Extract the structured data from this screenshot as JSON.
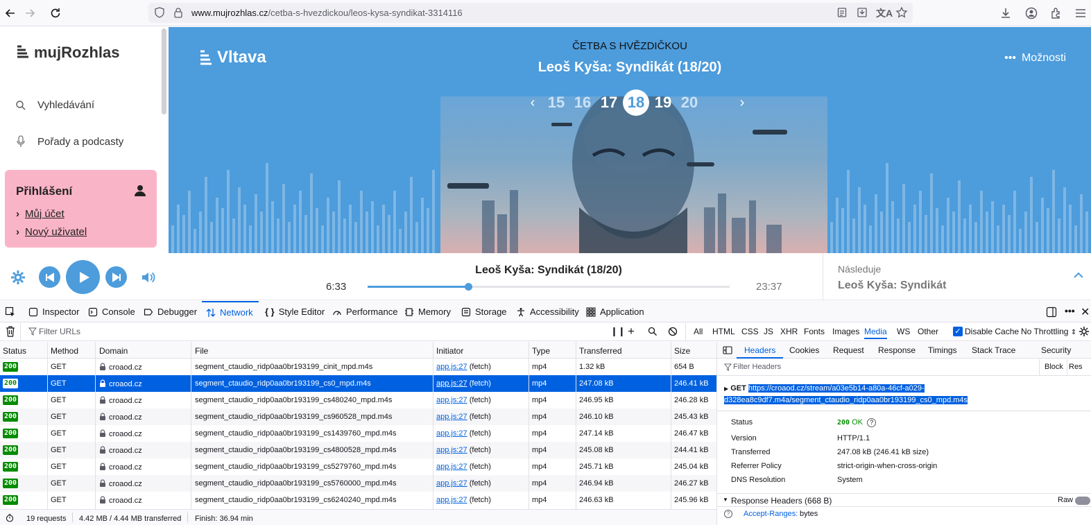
{
  "browser": {
    "url_domain": "www.mujrozhlas.cz",
    "url_path": "/cetba-s-hvezdickou/leos-kysa-syndikat-3314116"
  },
  "sidebar": {
    "logo": "mujRozhlas",
    "nav": [
      {
        "label": "Vyhledávání",
        "icon": "search-icon"
      },
      {
        "label": "Pořady a podcasty",
        "icon": "microphone-icon"
      }
    ],
    "login": {
      "title": "Přihlášení",
      "links": [
        "Můj účet",
        "Nový uživatel"
      ]
    }
  },
  "hero": {
    "station": "Vltava",
    "series": "ČETBA S HVĚZDIČKOU",
    "episode_title": "Leoš Kyša: Syndikát (18/20)",
    "options_label": "Možnosti",
    "episodes": [
      "15",
      "16",
      "17",
      "18",
      "19",
      "20"
    ],
    "current_episode": "18"
  },
  "player": {
    "title": "Leoš Kyša: Syndikát (18/20)",
    "time_current": "6:33",
    "time_total": "23:37",
    "progress": 0.277,
    "next_label": "Následuje",
    "next_title": "Leoš Kyša: Syndikát",
    "accent": "#4d9cdc"
  },
  "devtools": {
    "tabs": [
      "Inspector",
      "Console",
      "Debugger",
      "Network",
      "Style Editor",
      "Performance",
      "Memory",
      "Storage",
      "Accessibility",
      "Application"
    ],
    "selected_tab": "Network",
    "filter_placeholder": "Filter URLs",
    "type_filters": [
      "All",
      "HTML",
      "CSS",
      "JS",
      "XHR",
      "Fonts",
      "Images",
      "Media",
      "WS",
      "Other"
    ],
    "selected_type": "Media",
    "disable_cache_label": "Disable Cache",
    "disable_cache_checked": true,
    "throttling": "No Throttling",
    "columns": [
      "Status",
      "Method",
      "Domain",
      "File",
      "Initiator",
      "Type",
      "Transferred",
      "Size"
    ],
    "requests": [
      {
        "status": "200",
        "method": "GET",
        "domain": "croaod.cz",
        "file": "segment_ctaudio_ridp0aa0br193199_cinit_mpd.m4s",
        "initiator_link": "app.js:27",
        "initiator_cause": "(fetch)",
        "type": "mp4",
        "transferred": "1.32 kB",
        "size": "654 B"
      },
      {
        "status": "200",
        "method": "GET",
        "domain": "croaod.cz",
        "file": "segment_ctaudio_ridp0aa0br193199_cs0_mpd.m4s",
        "initiator_link": "app.js:27",
        "initiator_cause": "(fetch)",
        "type": "mp4",
        "transferred": "247.08 kB",
        "size": "246.41 kB"
      },
      {
        "status": "200",
        "method": "GET",
        "domain": "croaod.cz",
        "file": "segment_ctaudio_ridp0aa0br193199_cs480240_mpd.m4s",
        "initiator_link": "app.js:27",
        "initiator_cause": "(fetch)",
        "type": "mp4",
        "transferred": "246.95 kB",
        "size": "246.28 kB"
      },
      {
        "status": "200",
        "method": "GET",
        "domain": "croaod.cz",
        "file": "segment_ctaudio_ridp0aa0br193199_cs960528_mpd.m4s",
        "initiator_link": "app.js:27",
        "initiator_cause": "(fetch)",
        "type": "mp4",
        "transferred": "246.10 kB",
        "size": "245.43 kB"
      },
      {
        "status": "200",
        "method": "GET",
        "domain": "croaod.cz",
        "file": "segment_ctaudio_ridp0aa0br193199_cs1439760_mpd.m4s",
        "initiator_link": "app.js:27",
        "initiator_cause": "(fetch)",
        "type": "mp4",
        "transferred": "247.14 kB",
        "size": "246.47 kB"
      },
      {
        "status": "200",
        "method": "GET",
        "domain": "croaod.cz",
        "file": "segment_ctaudio_ridp0aa0br193199_cs4800528_mpd.m4s",
        "initiator_link": "app.js:27",
        "initiator_cause": "(fetch)",
        "type": "mp4",
        "transferred": "245.08 kB",
        "size": "244.41 kB"
      },
      {
        "status": "200",
        "method": "GET",
        "domain": "croaod.cz",
        "file": "segment_ctaudio_ridp0aa0br193199_cs5279760_mpd.m4s",
        "initiator_link": "app.js:27",
        "initiator_cause": "(fetch)",
        "type": "mp4",
        "transferred": "245.71 kB",
        "size": "245.04 kB"
      },
      {
        "status": "200",
        "method": "GET",
        "domain": "croaod.cz",
        "file": "segment_ctaudio_ridp0aa0br193199_cs5760000_mpd.m4s",
        "initiator_link": "app.js:27",
        "initiator_cause": "(fetch)",
        "type": "mp4",
        "transferred": "246.94 kB",
        "size": "246.27 kB"
      },
      {
        "status": "200",
        "method": "GET",
        "domain": "croaod.cz",
        "file": "segment_ctaudio_ridp0aa0br193199_cs6240240_mpd.m4s",
        "initiator_link": "app.js:27",
        "initiator_cause": "(fetch)",
        "type": "mp4",
        "transferred": "246.63 kB",
        "size": "245.96 kB"
      }
    ],
    "selected_row": 1,
    "status_bar": {
      "requests": "19 requests",
      "transferred": "4.42 MB / 4.44 MB transferred",
      "finish": "Finish: 36.94 min"
    },
    "panel": {
      "tabs": [
        "Headers",
        "Cookies",
        "Request",
        "Response",
        "Timings",
        "Stack Trace",
        "Security"
      ],
      "selected_tab": "Headers",
      "filter_placeholder": "Filter Headers",
      "block_label": "Block",
      "resend_label": "Res",
      "method": "GET",
      "url": "https://croaod.cz/stream/a03e5b14-a80a-46cf-a029-d328ea8c9df7.m4a/segment_ctaudio_ridp0aa0br193199_cs0_mpd.m4s",
      "status_label": "Status",
      "status_code": "200",
      "status_text": "OK",
      "fields": [
        {
          "key": "Version",
          "value": "HTTP/1.1"
        },
        {
          "key": "Transferred",
          "value": "247.08 kB (246.41 kB size)"
        },
        {
          "key": "Referrer Policy",
          "value": "strict-origin-when-cross-origin"
        },
        {
          "key": "DNS Resolution",
          "value": "System"
        }
      ],
      "response_headers_label": "Response Headers (668 B)",
      "raw_label": "Raw",
      "first_header_key": "Accept-Ranges:",
      "first_header_value": "bytes"
    }
  }
}
